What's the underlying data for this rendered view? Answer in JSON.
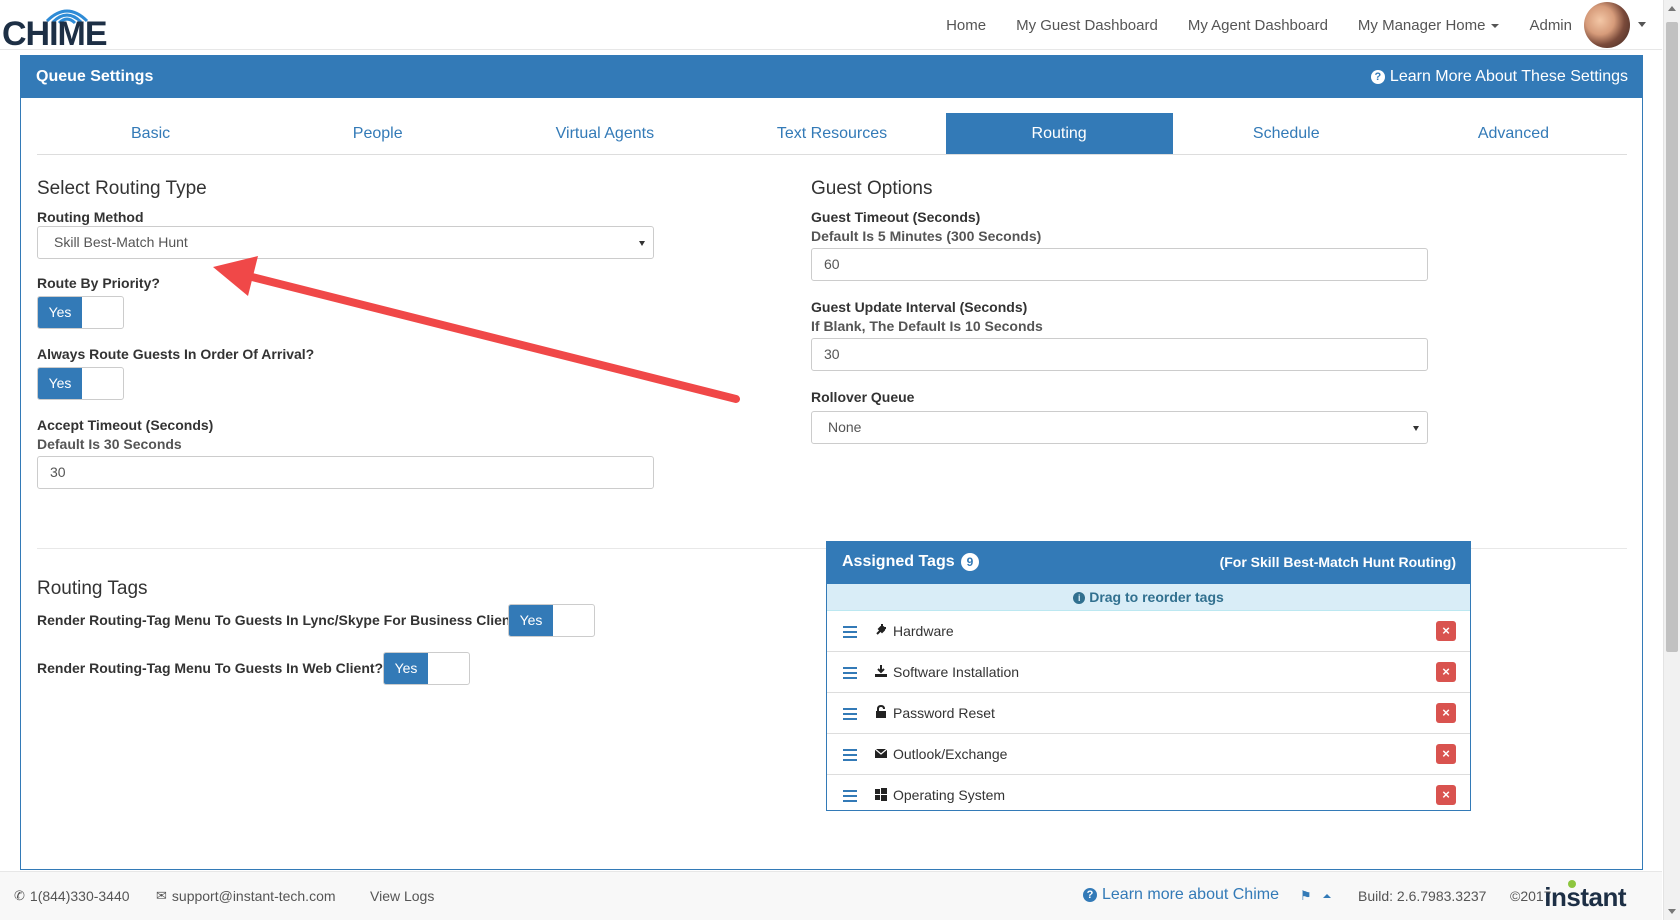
{
  "nav": {
    "logo": "CHIME",
    "links": [
      "Home",
      "My Guest Dashboard",
      "My Agent Dashboard",
      "My Manager Home",
      "Admin"
    ]
  },
  "panel": {
    "title": "Queue Settings",
    "learn_more": "Learn More About These Settings"
  },
  "tabs": [
    "Basic",
    "People",
    "Virtual Agents",
    "Text Resources",
    "Routing",
    "Schedule",
    "Advanced"
  ],
  "active_tab": "Routing",
  "routing": {
    "section_title": "Select Routing Type",
    "method_label": "Routing Method",
    "method_value": "Skill Best-Match Hunt",
    "priority_label": "Route By Priority?",
    "priority_value": "Yes",
    "order_label": "Always Route Guests In Order Of Arrival?",
    "order_value": "Yes",
    "accept_label": "Accept Timeout (Seconds)",
    "accept_sublabel": "Default Is 30 Seconds",
    "accept_value": "30"
  },
  "guest": {
    "section_title": "Guest Options",
    "timeout_label": "Guest Timeout (Seconds)",
    "timeout_sublabel": "Default Is 5 Minutes (300 Seconds)",
    "timeout_value": "60",
    "update_label": "Guest Update Interval (Seconds)",
    "update_sublabel": "If Blank, The Default Is 10 Seconds",
    "update_value": "30",
    "rollover_label": "Rollover Queue",
    "rollover_value": "None"
  },
  "tags": {
    "section_title": "Routing Tags",
    "lync_label": "Render Routing-Tag Menu To Guests In Lync/Skype For Business Client?",
    "lync_value": "Yes",
    "web_label": "Render Routing-Tag Menu To Guests In Web Client?",
    "web_value": "Yes",
    "assigned_title": "Assigned Tags",
    "assigned_count": "9",
    "assigned_note": "(For Skill Best-Match Hunt Routing)",
    "drag_note": "Drag to reorder tags",
    "items": [
      {
        "label": "Hardware",
        "icon": "plug-icon"
      },
      {
        "label": "Software Installation",
        "icon": "download-icon"
      },
      {
        "label": "Password Reset",
        "icon": "lock-icon"
      },
      {
        "label": "Outlook/Exchange",
        "icon": "envelope-icon"
      },
      {
        "label": "Operating System",
        "icon": "windows-icon"
      }
    ]
  },
  "footer": {
    "phone": "1(844)330-3440",
    "email": "support@instant-tech.com",
    "view_logs": "View Logs",
    "learn_more": "Learn more about Chime",
    "build": "Build: 2.6.7983.3237",
    "copyright": "©2017",
    "brand": "instant"
  },
  "colors": {
    "primary": "#337ab7",
    "danger": "#d9534f",
    "annotation": "#f04848"
  }
}
